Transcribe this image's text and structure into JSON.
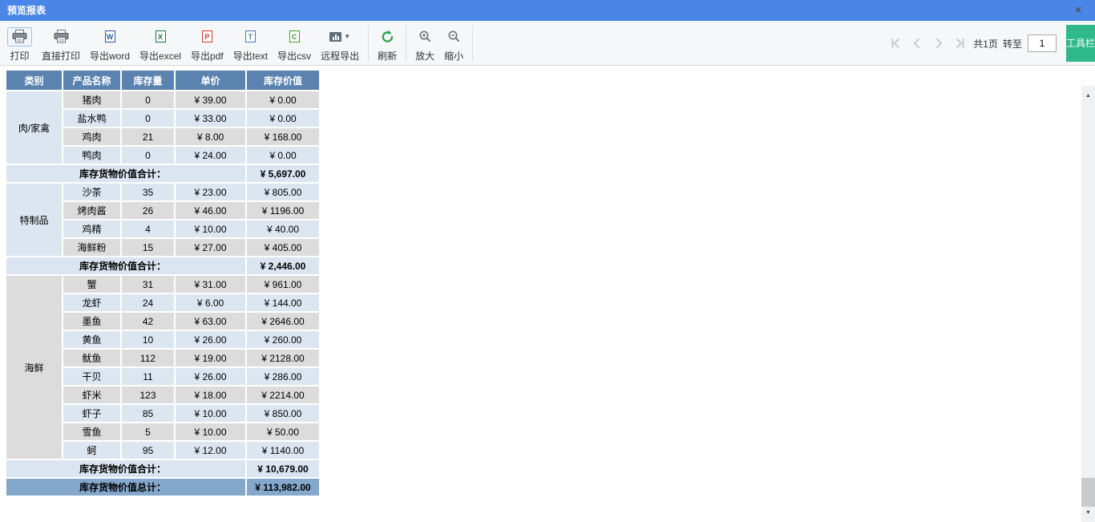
{
  "window": {
    "title": "预览报表",
    "close_glyph": "×"
  },
  "toolbar": {
    "buttons": [
      {
        "id": "print",
        "label": "打印",
        "icon": "printer-icon",
        "selected": true
      },
      {
        "id": "direct-print",
        "label": "直接打印",
        "icon": "printer-icon"
      },
      {
        "id": "export-word",
        "label": "导出word",
        "icon": "word-doc-icon",
        "letter": "W",
        "color": "#2b579a"
      },
      {
        "id": "export-excel",
        "label": "导出excel",
        "icon": "excel-doc-icon",
        "letter": "X",
        "color": "#1e7145"
      },
      {
        "id": "export-pdf",
        "label": "导出pdf",
        "icon": "pdf-doc-icon",
        "letter": "P",
        "color": "#d83b2b"
      },
      {
        "id": "export-text",
        "label": "导出text",
        "icon": "text-doc-icon",
        "letter": "T",
        "color": "#4a78b0"
      },
      {
        "id": "export-csv",
        "label": "导出csv",
        "icon": "csv-doc-icon",
        "letter": "C",
        "color": "#3f9c35"
      },
      {
        "id": "remote-export",
        "label": "远程导出",
        "icon": "remote-export-icon",
        "dropdown": true
      }
    ],
    "refresh_label": "刷新",
    "zoom_in_label": "放大",
    "zoom_out_label": "缩小",
    "pagination": {
      "pages_label": "共1页",
      "goto_label": "转至",
      "page_value": "1"
    },
    "tool_panel_toggle_label": "工具栏"
  },
  "report": {
    "columns": [
      "类别",
      "产品名称",
      "库存量",
      "单价",
      "库存价值"
    ],
    "groups": [
      {
        "category": "肉/家禽",
        "category_shade": "blue",
        "rows": [
          {
            "name": "猪肉",
            "qty": "0",
            "price": "¥ 39.00",
            "value": "¥ 0.00"
          },
          {
            "name": "盐水鸭",
            "qty": "0",
            "price": "¥ 33.00",
            "value": "¥ 0.00"
          },
          {
            "name": "鸡肉",
            "qty": "21",
            "price": "¥ 8.00",
            "value": "¥ 168.00"
          },
          {
            "name": "鸭肉",
            "qty": "0",
            "price": "¥ 24.00",
            "value": "¥ 0.00"
          }
        ],
        "subtotal_label": "库存货物价值合计：",
        "subtotal_value": "¥ 5,697.00"
      },
      {
        "category": "特制品",
        "category_shade": "blue",
        "rows": [
          {
            "name": "沙茶",
            "qty": "35",
            "price": "¥ 23.00",
            "value": "¥ 805.00"
          },
          {
            "name": "烤肉酱",
            "qty": "26",
            "price": "¥ 46.00",
            "value": "¥ 1196.00"
          },
          {
            "name": "鸡精",
            "qty": "4",
            "price": "¥ 10.00",
            "value": "¥ 40.00"
          },
          {
            "name": "海鲜粉",
            "qty": "15",
            "price": "¥ 27.00",
            "value": "¥ 405.00"
          }
        ],
        "subtotal_label": "库存货物价值合计：",
        "subtotal_value": "¥ 2,446.00"
      },
      {
        "category": "海鲜",
        "category_shade": "gray",
        "rows": [
          {
            "name": "蟹",
            "qty": "31",
            "price": "¥ 31.00",
            "value": "¥ 961.00"
          },
          {
            "name": "龙虾",
            "qty": "24",
            "price": "¥ 6.00",
            "value": "¥ 144.00"
          },
          {
            "name": "墨鱼",
            "qty": "42",
            "price": "¥ 63.00",
            "value": "¥ 2646.00"
          },
          {
            "name": "黄鱼",
            "qty": "10",
            "price": "¥ 26.00",
            "value": "¥ 260.00"
          },
          {
            "name": "鱿鱼",
            "qty": "112",
            "price": "¥ 19.00",
            "value": "¥ 2128.00"
          },
          {
            "name": "干贝",
            "qty": "11",
            "price": "¥ 26.00",
            "value": "¥ 286.00"
          },
          {
            "name": "虾米",
            "qty": "123",
            "price": "¥ 18.00",
            "value": "¥ 2214.00"
          },
          {
            "name": "虾子",
            "qty": "85",
            "price": "¥ 10.00",
            "value": "¥ 850.00"
          },
          {
            "name": "雪鱼",
            "qty": "5",
            "price": "¥ 10.00",
            "value": "¥ 50.00"
          },
          {
            "name": "蚵",
            "qty": "95",
            "price": "¥ 12.00",
            "value": "¥ 1140.00"
          }
        ],
        "subtotal_label": "库存货物价值合计：",
        "subtotal_value": "¥ 10,679.00"
      }
    ],
    "total_label": "库存货物价值总计：",
    "total_value": "¥ 113,982.00"
  },
  "colors": {
    "titlebar": "#4a86e8",
    "table_header": "#5b83b0",
    "row_gray": "#dcdcdc",
    "row_blue": "#dce6f1",
    "subtotal_band": "#dbe5f1",
    "total_band": "#84a7cc",
    "accent_green": "#2fb98a"
  }
}
